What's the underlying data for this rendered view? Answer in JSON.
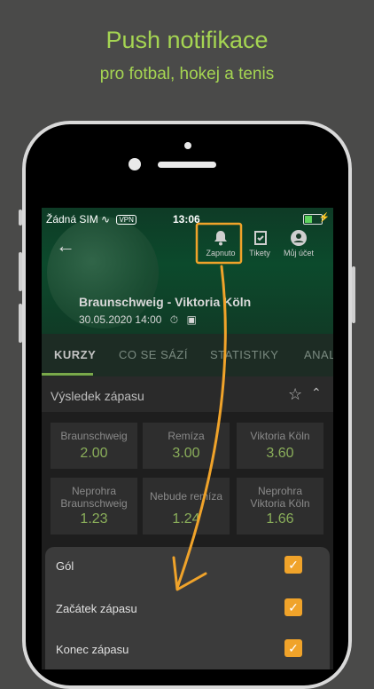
{
  "promo": {
    "title": "Push notifikace",
    "subtitle": "pro fotbal, hokej a tenis"
  },
  "status_bar": {
    "carrier": "Žádná SIM",
    "vpn": "VPN",
    "time": "13:06"
  },
  "header": {
    "back_icon": "arrow-left-icon",
    "buttons": [
      {
        "label": "Zapnuto",
        "icon": "bell-icon"
      },
      {
        "label": "Tikety",
        "icon": "ticket-icon"
      },
      {
        "label": "Můj účet",
        "icon": "user-icon"
      }
    ],
    "match": "Braunschweig - Viktoria Köln",
    "date": "30.05.2020 14:00"
  },
  "tabs": [
    "KURZY",
    "CO SE SÁZÍ",
    "STATISTIKY",
    "ANAL"
  ],
  "section": {
    "title": "Výsledek zápasu"
  },
  "odds": [
    {
      "label": "Braunschweig",
      "value": "2.00"
    },
    {
      "label": "Remíza",
      "value": "3.00"
    },
    {
      "label": "Viktoria Köln",
      "value": "3.60"
    },
    {
      "label": "Neprohra Braunschweig",
      "value": "1.23"
    },
    {
      "label": "Nebude remíza",
      "value": "1.24"
    },
    {
      "label": "Neprohra Viktoria Köln",
      "value": "1.66"
    }
  ],
  "notifications": [
    {
      "label": "Gól",
      "checked": true
    },
    {
      "label": "Začátek zápasu",
      "checked": true
    },
    {
      "label": "Konec zápasu",
      "checked": true
    }
  ],
  "colors": {
    "accent": "#a5d552",
    "checkbox": "#f0a32a",
    "odds": "#8aae5a"
  }
}
